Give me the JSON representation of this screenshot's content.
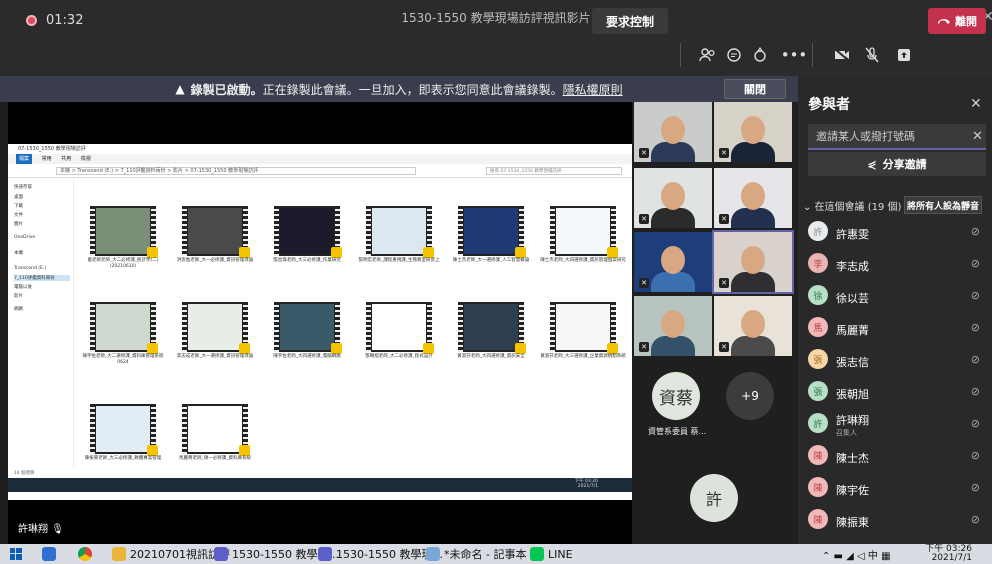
{
  "window": {
    "title": "1530-1550 教學現場訪評視訊影片"
  },
  "toolbar": {
    "timer": "01:32",
    "request_control": "要求控制",
    "leave": "離開"
  },
  "banner": {
    "bold": "錄製已啟動。",
    "text": "正在錄製此會議。一旦加入，即表示您同意此會議錄製。",
    "link": "隱私權原則",
    "close": "關閉"
  },
  "shared_screen": {
    "explorer_title": "07-1530_1550 教學現場訪評",
    "ribbon": [
      "檔案",
      "常用",
      "共用",
      "檢視"
    ],
    "address": "本機 > Transcend (E:) > 7_110評鑑資料兩份 > 影片 > 07-1530_1550 教學現場訪評",
    "search": "搜尋 07-1530_1550 教學現場訪評",
    "nav": [
      "快速存取",
      "桌面",
      "下載",
      "文件",
      "圖片",
      "OneDrive",
      "本機",
      "Transcend (E:)",
      "7_110評鑑資料兩份",
      "電腦以後",
      "影片",
      "網路"
    ],
    "files": [
      "童老師老師_大二必修課_統計學(二)(20210610)",
      "洪思惟老師_大一必修課_資訊管理導論",
      "張昌偉老師_大三必修課_作業研究",
      "張明宏老師_課程重視課_生態教室研習上",
      "陳士杰老師_大一選修課_人工智慧概論",
      "陳士杰老師_大四選修課_資訊管理個案研究",
      "陳宇佐老師_大二選修課_資料庫管理系統0624",
      "李志成老師_大一選修課_資訊管理導論",
      "陳宇佐老師_大四選修課_電腦網路",
      "張朝旭老師_大二必修課_程式設計",
      "黃淑芬老師_大四選修課_資訊安全",
      "黃淑芬老師_大三選修課_企業資源規劃系統",
      "陳振東老師_大三必修課_軟體專案管理",
      "馬麗菁老師_碩一必修課_資料庫系統"
    ],
    "status": "14 個項目",
    "clock_time": "下午 03:26",
    "clock_date": "2021/7/1",
    "presenter": "許琳翔"
  },
  "video_grid": {
    "tile_label": "資管系委員 蔡...",
    "tile_initials": "資蔡",
    "overflow": "+9",
    "self_initial": "許"
  },
  "participants": {
    "title": "參與者",
    "invite_placeholder": "邀請某人或撥打號碼",
    "share_invite": "分享邀請",
    "section": "在這個會議 (19 個)",
    "mute_all": "將所有人設為靜音",
    "list": [
      {
        "initial": "許",
        "name": "許惠雯",
        "role": "",
        "color": "#e8ecef",
        "text": "#888"
      },
      {
        "initial": "李",
        "name": "李志成",
        "role": "",
        "color": "#e8b4b4",
        "text": "#b44"
      },
      {
        "initial": "徐",
        "name": "徐以芸",
        "role": "",
        "color": "#b7dfc4",
        "text": "#2b7a46"
      },
      {
        "initial": "馬",
        "name": "馬麗菁",
        "role": "",
        "color": "#f0b8b8",
        "text": "#b44"
      },
      {
        "initial": "張",
        "name": "張志信",
        "role": "",
        "color": "#f6d5a6",
        "text": "#a46a1a"
      },
      {
        "initial": "張",
        "name": "張朝旭",
        "role": "",
        "color": "#b7dfc4",
        "text": "#2b7a46"
      },
      {
        "initial": "許",
        "name": "許琳翔",
        "role": "召集人",
        "color": "#b7dfc4",
        "text": "#2b7a46"
      },
      {
        "initial": "陳",
        "name": "陳士杰",
        "role": "",
        "color": "#f0b8b8",
        "text": "#b44"
      },
      {
        "initial": "陳",
        "name": "陳宇佐",
        "role": "",
        "color": "#f0b8b8",
        "text": "#b44"
      },
      {
        "initial": "陳",
        "name": "陳振東",
        "role": "",
        "color": "#f0b8b8",
        "text": "#b44"
      }
    ]
  },
  "taskbar": {
    "items": [
      "20210701視訊訪評",
      "1530-1550 教學現...",
      "1530-1550 教學現...",
      "*未命名 - 記事本",
      "LINE"
    ],
    "time": "下午 03:26",
    "date": "2021/7/1"
  }
}
